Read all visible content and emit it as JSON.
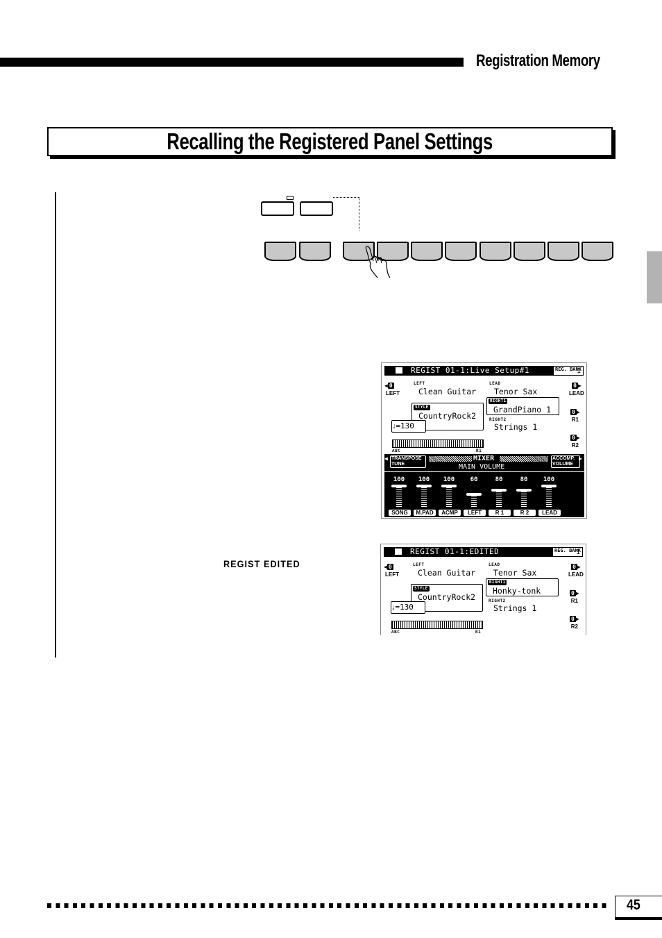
{
  "header": {
    "section_name": "Registration Memory"
  },
  "section": {
    "title": "Recalling the Registered Panel Settings"
  },
  "panel_diagram": {
    "top_buttons": 2,
    "registration_buttons": 10,
    "pressed_button_index": 2,
    "hand_icon": "pointing-hand-icon"
  },
  "screen1": {
    "title": "REGIST 01-1:Live Setup#1",
    "bank_label": "REG. BANK",
    "bank_value": "1",
    "left": {
      "tag": "LEFT",
      "voice": "Clean Guitar",
      "side_label": "LEFT",
      "octave": "0"
    },
    "lead": {
      "tag": "LEAD",
      "voice": "Tenor Sax",
      "side_label": "LEAD",
      "octave": "0"
    },
    "right1": {
      "tag": "RIGHT1",
      "voice": "GrandPiano 1",
      "side_label": "R1",
      "octave": "0"
    },
    "right2": {
      "tag": "RIGHT2",
      "voice": "Strings 1",
      "side_label": "R2",
      "octave": "0"
    },
    "style": {
      "tag": "STYLE",
      "name": "CountryRock2"
    },
    "tempo": "=130",
    "keyboard_left_label": "ABC",
    "keyboard_right_label": "R1",
    "mixer": {
      "transpose_label": "TRANSPOSE",
      "tune_label": "TUNE",
      "title": "MIXER",
      "subtitle": "MAIN VOLUME",
      "accomp_label": "ACCOMP.",
      "volume_label": "VOLUME",
      "channels": [
        {
          "label": "SONG",
          "value": 100
        },
        {
          "label": "M.PAD",
          "value": 100
        },
        {
          "label": "ACMP",
          "value": 100
        },
        {
          "label": "LEFT",
          "value": 60
        },
        {
          "label": "R 1",
          "value": 80
        },
        {
          "label": "R 2",
          "value": 80
        },
        {
          "label": "LEAD",
          "value": 100
        }
      ]
    }
  },
  "regist_edited_label": "REGIST EDITED",
  "screen2": {
    "title": "REGIST 01-1:EDITED",
    "bank_label": "REG. BANK",
    "bank_value": "1",
    "left": {
      "tag": "LEFT",
      "voice": "Clean Guitar",
      "side_label": "LEFT",
      "octave": "0"
    },
    "lead": {
      "tag": "LEAD",
      "voice": "Tenor Sax",
      "side_label": "LEAD",
      "octave": "0"
    },
    "right1": {
      "tag": "RIGHT1",
      "voice": "Honky-tonk",
      "side_label": "R1",
      "octave": "0"
    },
    "right2": {
      "tag": "RIGHT2",
      "voice": "Strings 1",
      "side_label": "R2",
      "octave": "0"
    },
    "style": {
      "tag": "STYLE",
      "name": "CountryRock2"
    },
    "tempo": "=130",
    "keyboard_left_label": "ABC",
    "keyboard_right_label": "R1"
  },
  "footer": {
    "page_number": "45"
  }
}
